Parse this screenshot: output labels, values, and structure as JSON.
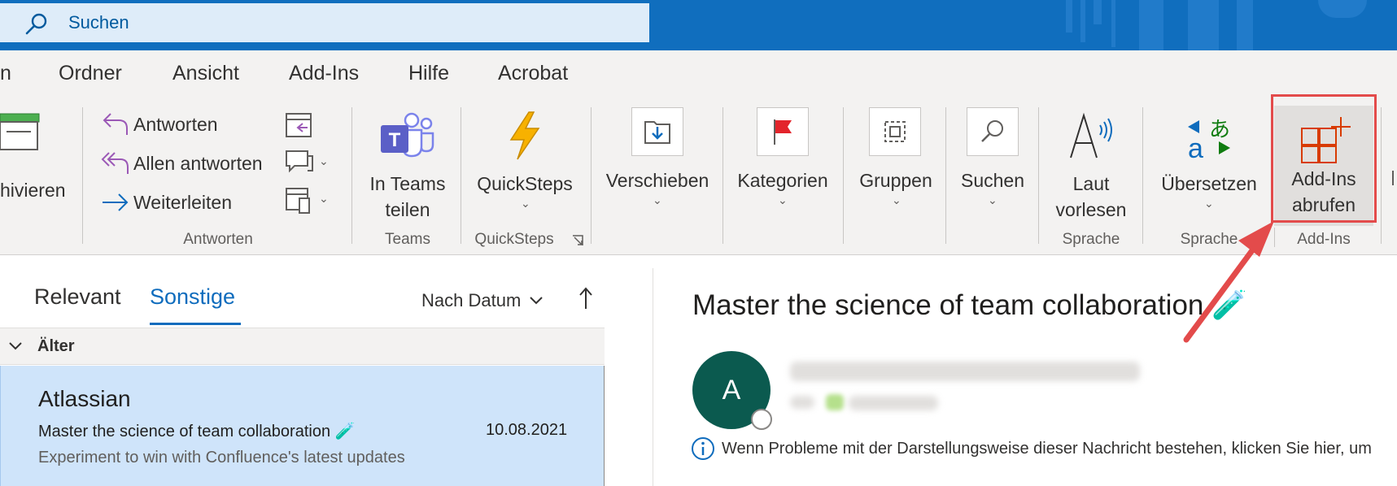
{
  "search": {
    "placeholder": "Suchen"
  },
  "menu": {
    "tabs": [
      "n",
      "Ordner",
      "Ansicht",
      "Add-Ins",
      "Hilfe",
      "Acrobat"
    ]
  },
  "ribbon": {
    "archive_label": "hivieren",
    "antworten": {
      "reply": "Antworten",
      "reply_all": "Allen antworten",
      "forward": "Weiterleiten",
      "group": "Antworten"
    },
    "teams": {
      "line1": "In Teams",
      "line2": "teilen",
      "group": "Teams"
    },
    "quicksteps": {
      "label": "QuickSteps",
      "group": "QuickSteps"
    },
    "move": {
      "label": "Verschieben"
    },
    "categories": {
      "label": "Kategorien"
    },
    "groups": {
      "label": "Gruppen"
    },
    "find": {
      "label": "Suchen"
    },
    "read_aloud": {
      "line1": "Laut",
      "line2": "vorlesen",
      "group": "Sprache"
    },
    "translate": {
      "label": "Übersetzen",
      "group": "Sprache"
    },
    "addins": {
      "line1": "Add-Ins",
      "line2": "abrufen",
      "group": "Add-Ins"
    },
    "colors": {
      "accent": "#0f6cbd",
      "highlight": "#e34b4b",
      "teams": "#5b5fc7",
      "quicksteps": "#f7b100",
      "flag": "#e3242b",
      "translate": "#107c10",
      "addins": "#d83b01"
    }
  },
  "list": {
    "tab_relevant": "Relevant",
    "tab_other": "Sonstige",
    "sort_label": "Nach Datum",
    "group_header": "Älter",
    "item": {
      "sender": "Atlassian",
      "subject": "Master the science of team collaboration 🧪",
      "date": "10.08.2021",
      "preview": "Experiment to win with Confluence's latest updates"
    }
  },
  "reading": {
    "title": "Master the science of team collaboration 🧪",
    "avatar_letter": "A",
    "info_text": "Wenn Probleme mit der Darstellungsweise dieser Nachricht bestehen, klicken Sie hier, um"
  }
}
